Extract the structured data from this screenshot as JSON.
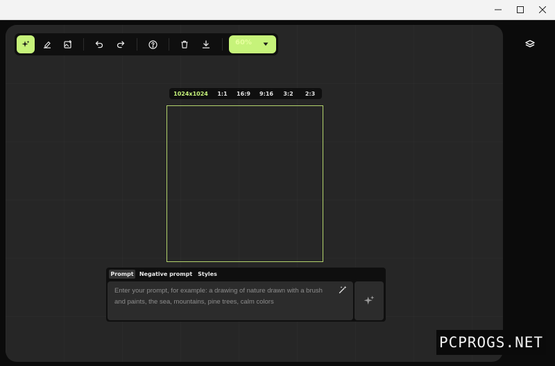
{
  "window": {
    "controls": [
      "minimize-icon",
      "maximize-icon",
      "close-icon"
    ]
  },
  "toolbar": {
    "tools": [
      "sparkles-icon",
      "eraser-icon",
      "image-add-icon",
      "undo-icon",
      "redo-icon",
      "help-icon",
      "trash-icon",
      "download-icon"
    ],
    "active_tool": "sparkles-icon",
    "zoom_label": "60%"
  },
  "aspect_ratios": {
    "options": [
      "1024x1024",
      "1:1",
      "16:9",
      "9:16",
      "3:2",
      "2:3"
    ],
    "selected": "1024x1024"
  },
  "prompt_panel": {
    "tabs": [
      "Prompt",
      "Negative prompt",
      "Styles"
    ],
    "active_tab": "Prompt",
    "placeholder": "Enter your prompt, for example: a drawing of nature drawn with a brush and paints, the sea, mountains, pine trees, calm colors"
  },
  "side_panel": {
    "icon": "layers-icon"
  },
  "watermark": "PCPROGS.NET",
  "colors": {
    "accent": "#c6f37a",
    "workspace": "#262626",
    "panel": "#0f0f0f",
    "page": "#0b0b0b"
  }
}
